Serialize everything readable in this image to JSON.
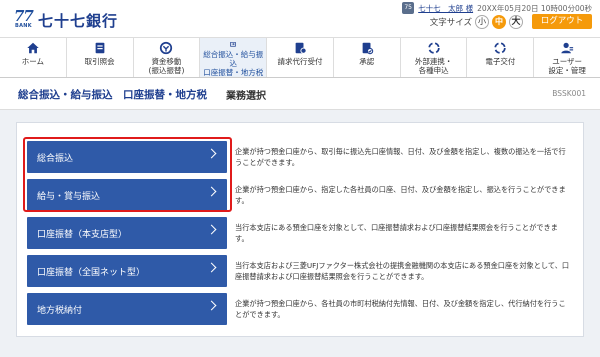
{
  "header": {
    "logo_number": "77",
    "logo_bank": "BANK",
    "logo_text": "七十七銀行",
    "user_icon": "75",
    "user_name": "七十七　太郎 様",
    "last_login": "20XX年05月20日 10時00分00秒",
    "font_size_label": "文字サイズ",
    "font_sizes": [
      "小",
      "中",
      "大"
    ],
    "active_font_size": "中",
    "logout_label": "ログアウト",
    "colors": {
      "brand": "#1f3f8f",
      "accent": "#f59a0b"
    }
  },
  "nav": {
    "items": [
      {
        "label": "ホーム",
        "icon": "home-icon"
      },
      {
        "label": "取引照会",
        "icon": "inquiry-icon"
      },
      {
        "label": "資金移動\n(振込振替)",
        "icon": "transfer-icon"
      },
      {
        "label": "総合振込・給与振込\n口座振替・地方税",
        "icon": "bulk-transfer-icon",
        "active": true
      },
      {
        "label": "請求代行受付",
        "icon": "billing-icon"
      },
      {
        "label": "承認",
        "icon": "approval-icon"
      },
      {
        "label": "外部連携・\n各種申込",
        "icon": "link-icon"
      },
      {
        "label": "電子交付",
        "icon": "document-icon"
      },
      {
        "label": "ユーザー\n設定・管理",
        "icon": "user-settings-icon"
      }
    ]
  },
  "page": {
    "title": "総合振込・給与振込　口座振替・地方税",
    "subtitle": "業務選択",
    "code": "BSSK001"
  },
  "menu": [
    {
      "label": "総合振込",
      "description": "企業が持つ預金口座から、取引毎に振込先口座情報、日付、及び金額を指定し、複数の振込を一括で行うことができます。"
    },
    {
      "label": "給与・賞与振込",
      "description": "企業が持つ預金口座から、指定した各社員の口座、日付、及び金額を指定し、振込を行うことができます。"
    },
    {
      "label": "口座振替（本支店型）",
      "description": "当行本支店にある預金口座を対象として、口座振替請求および口座振替結果照会を行うことができます。"
    },
    {
      "label": "口座振替（全国ネット型）",
      "description": "当行本支店および三菱UFJファクター株式会社の提携金融機関の本支店にある預金口座を対象として、口座振替請求および口座振替結果照会を行うことができます。"
    },
    {
      "label": "地方税納付",
      "description": "企業が持つ預金口座から、各社員の市町村税納付先情報、日付、及び金額を指定し、代行納付を行うことができます。"
    }
  ]
}
